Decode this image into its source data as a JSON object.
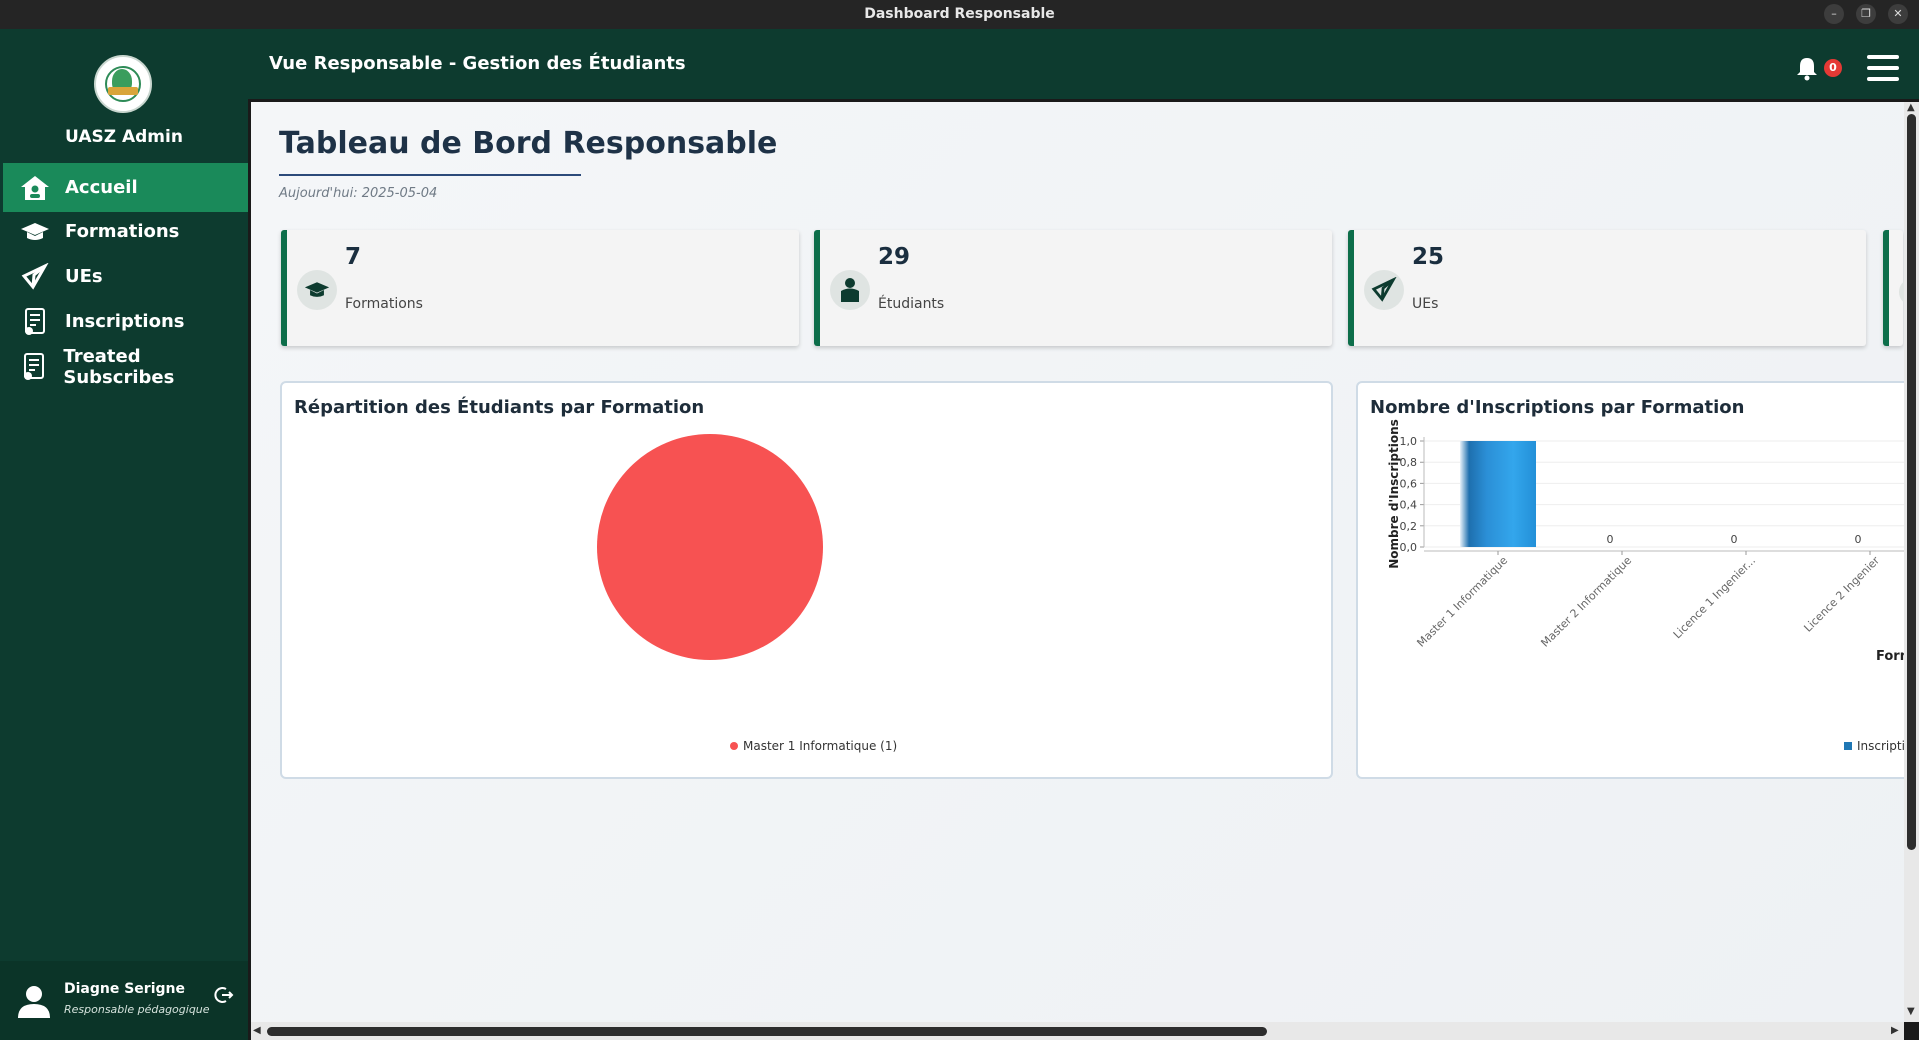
{
  "window": {
    "title": "Dashboard Responsable"
  },
  "sidebar": {
    "brand": "UASZ Admin",
    "items": [
      {
        "label": "Accueil",
        "icon": "home-icon",
        "active": true
      },
      {
        "label": "Formations",
        "icon": "graduation-cap-icon",
        "active": false
      },
      {
        "label": "UEs",
        "icon": "unity-icon",
        "active": false
      },
      {
        "label": "Inscriptions",
        "icon": "document-icon",
        "active": false
      },
      {
        "label": "Treated Subscribes",
        "icon": "document-icon",
        "active": false
      }
    ],
    "user": {
      "name": "Diagne Serigne",
      "role": "Responsable pédagogique"
    }
  },
  "header": {
    "title": "Vue Responsable - Gestion des Étudiants",
    "notifications": "0"
  },
  "main": {
    "title": "Tableau de Bord Responsable",
    "date": "Aujourd'hui: 2025-05-04",
    "stats": [
      {
        "value": "7",
        "label": "Formations",
        "icon": "graduation-cap-icon"
      },
      {
        "value": "29",
        "label": "Étudiants",
        "icon": "student-icon"
      },
      {
        "value": "25",
        "label": "UEs",
        "icon": "unity-icon"
      }
    ]
  },
  "charts": {
    "pie": {
      "title": "Répartition des Étudiants par Formation"
    },
    "bar": {
      "title": "Nombre d'Inscriptions par Formation"
    }
  },
  "chart_data": [
    {
      "type": "pie",
      "title": "Répartition des Étudiants par Formation",
      "categories": [
        "Master 1 Informatique"
      ],
      "values": [
        1
      ],
      "legend": [
        "Master 1 Informatique (1)"
      ],
      "colors": [
        "#f75252"
      ]
    },
    {
      "type": "bar",
      "title": "Nombre d'Inscriptions par Formation",
      "ylabel": "Nombre d'Inscriptions",
      "xlabel": "Form",
      "categories": [
        "Master 1 Informatique",
        "Master 2 Informatique",
        "Licence 1 Ingenier...",
        "Licence 2 Ingenier"
      ],
      "values": [
        1,
        0,
        0,
        0
      ],
      "data_labels": [
        "",
        "0",
        "0",
        "0"
      ],
      "yticks": [
        "0,0",
        "0,2",
        "0,4",
        "0,6",
        "0,8",
        "1,0"
      ],
      "ylim": [
        0,
        1
      ],
      "legend": [
        "Inscriptio"
      ],
      "colors": [
        "#2e9be0"
      ]
    }
  ]
}
